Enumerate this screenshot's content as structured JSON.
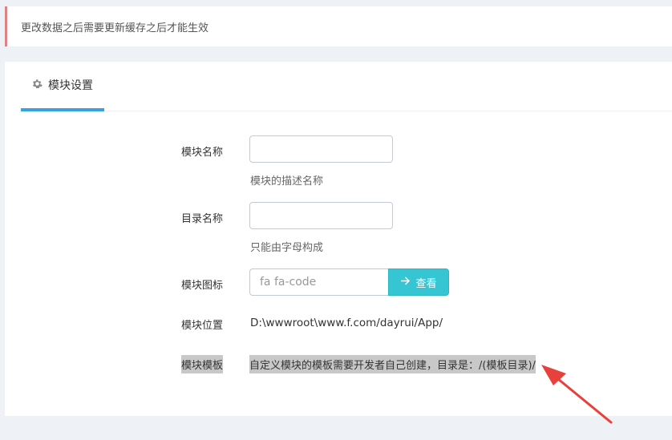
{
  "alert": {
    "text": "更改数据之后需要更新缓存之后才能生效"
  },
  "tabs": [
    {
      "label": "模块设置",
      "icon": "gear-icon"
    }
  ],
  "form": {
    "name": {
      "label": "模块名称",
      "value": "",
      "help": "模块的描述名称"
    },
    "dirname": {
      "label": "目录名称",
      "value": "",
      "help": "只能由字母构成"
    },
    "icon": {
      "label": "模块图标",
      "value": "",
      "placeholder": "fa fa-code",
      "button_label": "查看",
      "button_icon": "arrow-right-icon"
    },
    "path": {
      "label": "模块位置",
      "value": "D:\\wwwroot\\www.f.com/dayrui/App/"
    },
    "template": {
      "label": "模块模板",
      "value": "自定义模块的模板需要开发者自己创建，目录是：/(模板目录)/"
    }
  },
  "colors": {
    "accent": "#36a3e0",
    "alert_border": "#e08283",
    "button": "#36c6d3",
    "annotation_arrow": "#e8403a",
    "highlight": "#c8c8c8"
  }
}
